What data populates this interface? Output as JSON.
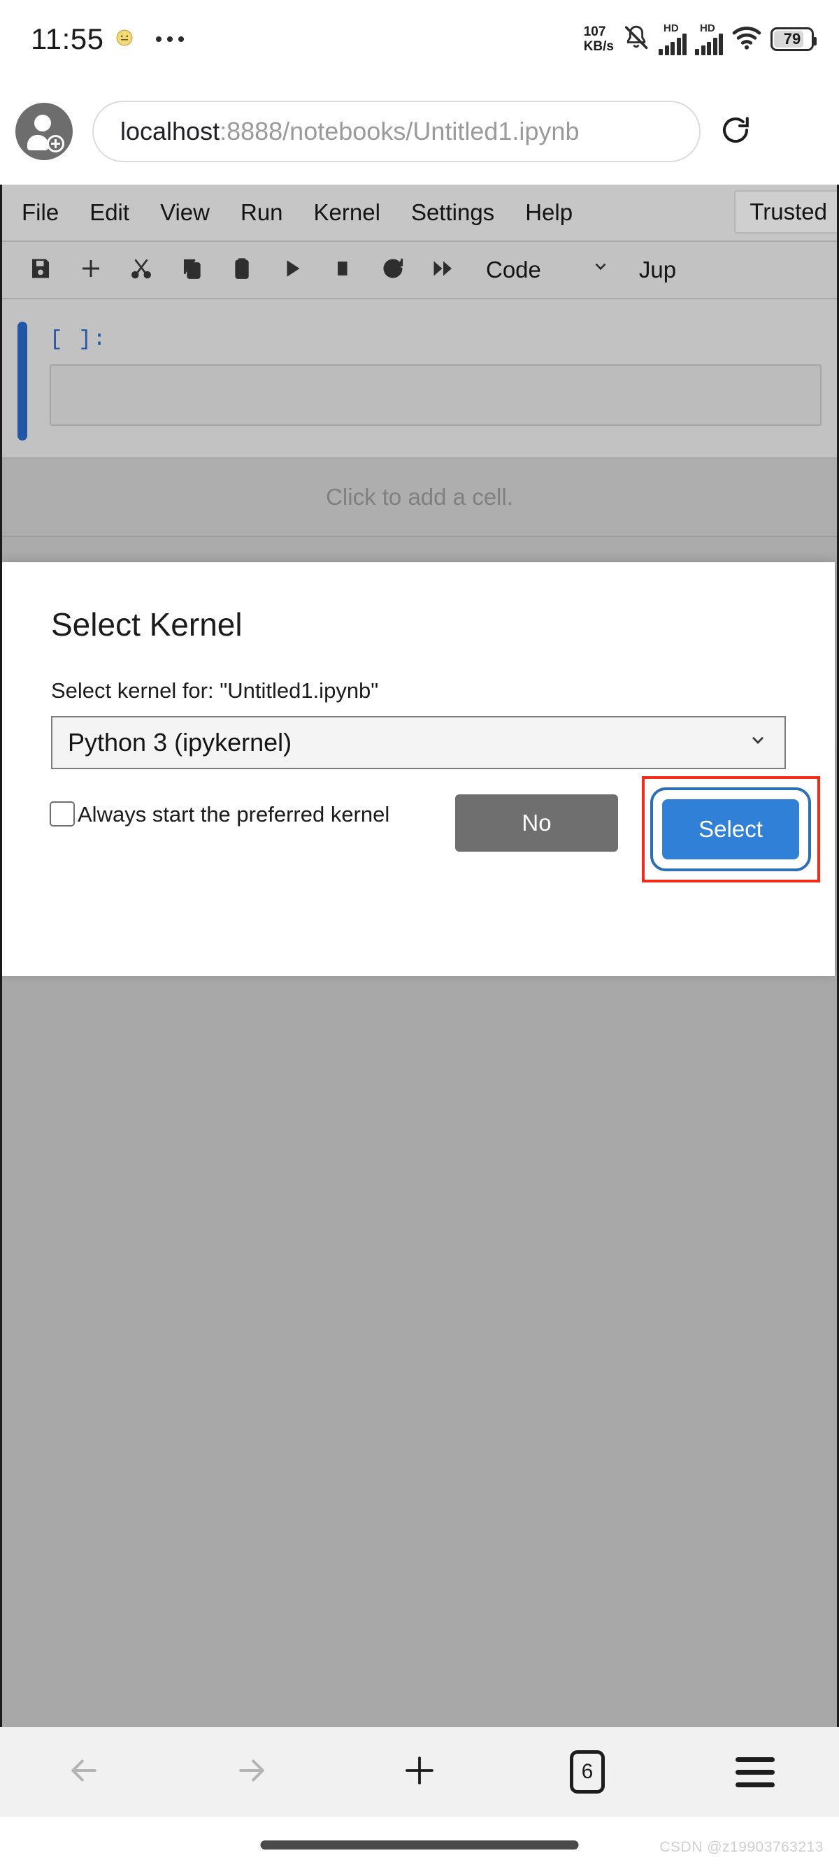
{
  "status_bar": {
    "time": "11:55",
    "emoji": "☺",
    "overflow_icon": "more-dots-icon",
    "network_speed_value": "107",
    "network_speed_unit": "KB/s",
    "mute_icon": "bell-muted-icon",
    "sim1_label": "HD",
    "sim2_label": "HD",
    "wifi_icon": "wifi-icon",
    "battery_level": "79"
  },
  "browser": {
    "profile_icon": "account-add-icon",
    "url_host": "localhost",
    "url_path": ":8888/notebooks/Untitled1.ipynb",
    "url_full": "localhost:8888/notebooks/Untitled1.ipynb",
    "reload_icon": "reload-icon",
    "bottom_nav": {
      "back_icon": "arrow-left-icon",
      "forward_icon": "arrow-right-icon",
      "new_tab_icon": "plus-icon",
      "tab_count": "6",
      "menu_icon": "hamburger-menu-icon"
    }
  },
  "jupyter": {
    "menus": [
      "File",
      "Edit",
      "View",
      "Run",
      "Kernel",
      "Settings",
      "Help"
    ],
    "trusted_label": "Trusted",
    "toolbar": {
      "icons": [
        "save-icon",
        "add-cell-icon",
        "cut-icon",
        "copy-icon",
        "paste-icon",
        "run-icon",
        "stop-icon",
        "restart-kernel-icon",
        "run-all-icon"
      ],
      "cell_type": "Code",
      "cell_type_chevron": "chevron-down-icon",
      "logo_text": "Jup"
    },
    "cell": {
      "prompt": "[ ]:",
      "code_value": ""
    },
    "add_cell_hint": "Click to add a cell."
  },
  "dialog": {
    "title": "Select Kernel",
    "subtitle": "Select kernel for: \"Untitled1.ipynb\"",
    "kernel_selected": "Python 3 (ipykernel)",
    "kernel_options": [
      "Python 3 (ipykernel)"
    ],
    "kernel_chevron": "chevron-down-icon",
    "checkbox_label": "Always start the preferred kernel",
    "checkbox_checked": false,
    "no_label": "No",
    "select_label": "Select",
    "annotation_color": "#f22c1b",
    "primary_color": "#3080d8",
    "secondary_color": "#6f6f6f"
  },
  "watermark": "CSDN @z19903763213"
}
